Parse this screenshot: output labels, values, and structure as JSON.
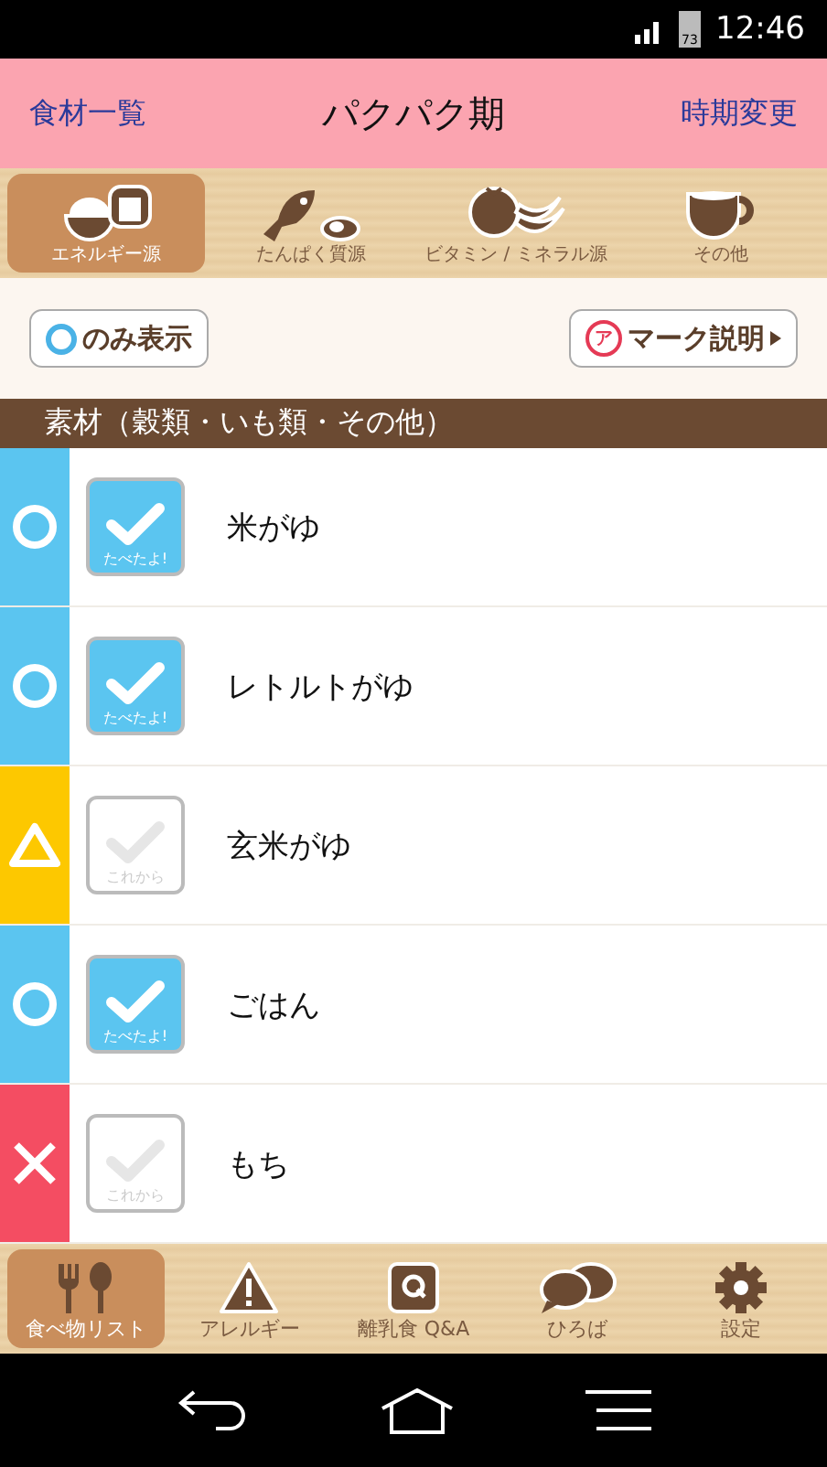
{
  "status_bar": {
    "battery": "73",
    "time": "12:46"
  },
  "header": {
    "left": "食材一覧",
    "title": "パクパク期",
    "right": "時期変更"
  },
  "categories": [
    {
      "label": "エネルギー源",
      "kind": "energy",
      "selected": true
    },
    {
      "label": "たんぱく質源",
      "kind": "protein",
      "selected": false
    },
    {
      "label": "ビタミン / ミネラル源",
      "kind": "vitamin",
      "selected": false
    },
    {
      "label": "その他",
      "kind": "other",
      "selected": false
    }
  ],
  "filter": {
    "only": "のみ表示",
    "legend_mark": "ア",
    "legend": "マーク説明"
  },
  "section": "素材（穀類・いも類・その他）",
  "foods": [
    {
      "name": "米がゆ",
      "kind": "circle",
      "color": "#5bc5f0",
      "eaten": true,
      "check_label": "たべたよ!"
    },
    {
      "name": "レトルトがゆ",
      "kind": "circle",
      "color": "#5bc5f0",
      "eaten": true,
      "check_label": "たべたよ!"
    },
    {
      "name": "玄米がゆ",
      "kind": "triangle",
      "color": "#fdc800",
      "eaten": false,
      "check_label": "これから"
    },
    {
      "name": "ごはん",
      "kind": "circle",
      "color": "#5bc5f0",
      "eaten": true,
      "check_label": "たべたよ!"
    },
    {
      "name": "もち",
      "kind": "cross",
      "color": "#f44d62",
      "eaten": false,
      "check_label": "これから"
    }
  ],
  "bottom_nav": [
    {
      "label": "食べ物リスト",
      "kind": "food",
      "selected": true
    },
    {
      "label": "アレルギー",
      "kind": "warning",
      "selected": false
    },
    {
      "label": "離乳食 Q&A",
      "kind": "qa",
      "selected": false
    },
    {
      "label": "ひろば",
      "kind": "chat",
      "selected": false
    },
    {
      "label": "設定",
      "kind": "gear",
      "selected": false
    }
  ]
}
